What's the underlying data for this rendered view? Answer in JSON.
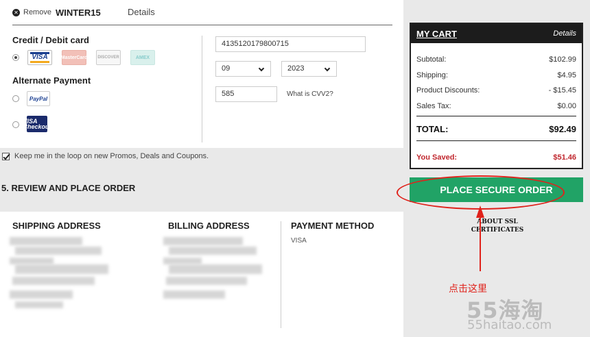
{
  "coupon": {
    "remove_label": "Remove",
    "code": "WINTER15",
    "details_label": "Details"
  },
  "payment": {
    "credit_title": "Credit / Debit card",
    "alt_title": "Alternate Payment",
    "cards": [
      "VISA",
      "MasterCard",
      "DISCOVER",
      "AMEX"
    ],
    "alt_methods": [
      "PayPal",
      "VISA Checkout"
    ],
    "card_number": "4135120179800715",
    "exp_month": "09",
    "exp_year": "2023",
    "cvv": "585",
    "cvv_link": "What is CVV2?"
  },
  "loop": {
    "label": "Keep me in the loop on new Promos, Deals and Coupons."
  },
  "review": {
    "title": "5. REVIEW AND PLACE ORDER",
    "shipping_title": "SHIPPING ADDRESS",
    "billing_title": "BILLING ADDRESS",
    "payment_title": "PAYMENT METHOD",
    "payment_value": "VISA"
  },
  "cart": {
    "title": "MY CART",
    "details_label": "Details",
    "subtotal_label": "Subtotal:",
    "subtotal": "$102.99",
    "shipping_label": "Shipping:",
    "shipping": "$4.95",
    "discount_label": "Product Discounts:",
    "discount": "- $15.45",
    "tax_label": "Sales Tax:",
    "tax": "$0.00",
    "total_label": "TOTAL:",
    "total": "$92.49",
    "saved_label": "You Saved:",
    "saved": "$51.46"
  },
  "order_button": "PLACE SECURE ORDER",
  "ssl": {
    "line1": "ABOUT SSL",
    "line2": "CERTIFICATES"
  },
  "annotation": "点击这里",
  "watermark": {
    "main": "55海淘",
    "sub": "55haitao.com"
  },
  "colors": {
    "accent_green": "#21a366",
    "saved_red": "#c0262d",
    "annotation_red": "#e0221b"
  }
}
